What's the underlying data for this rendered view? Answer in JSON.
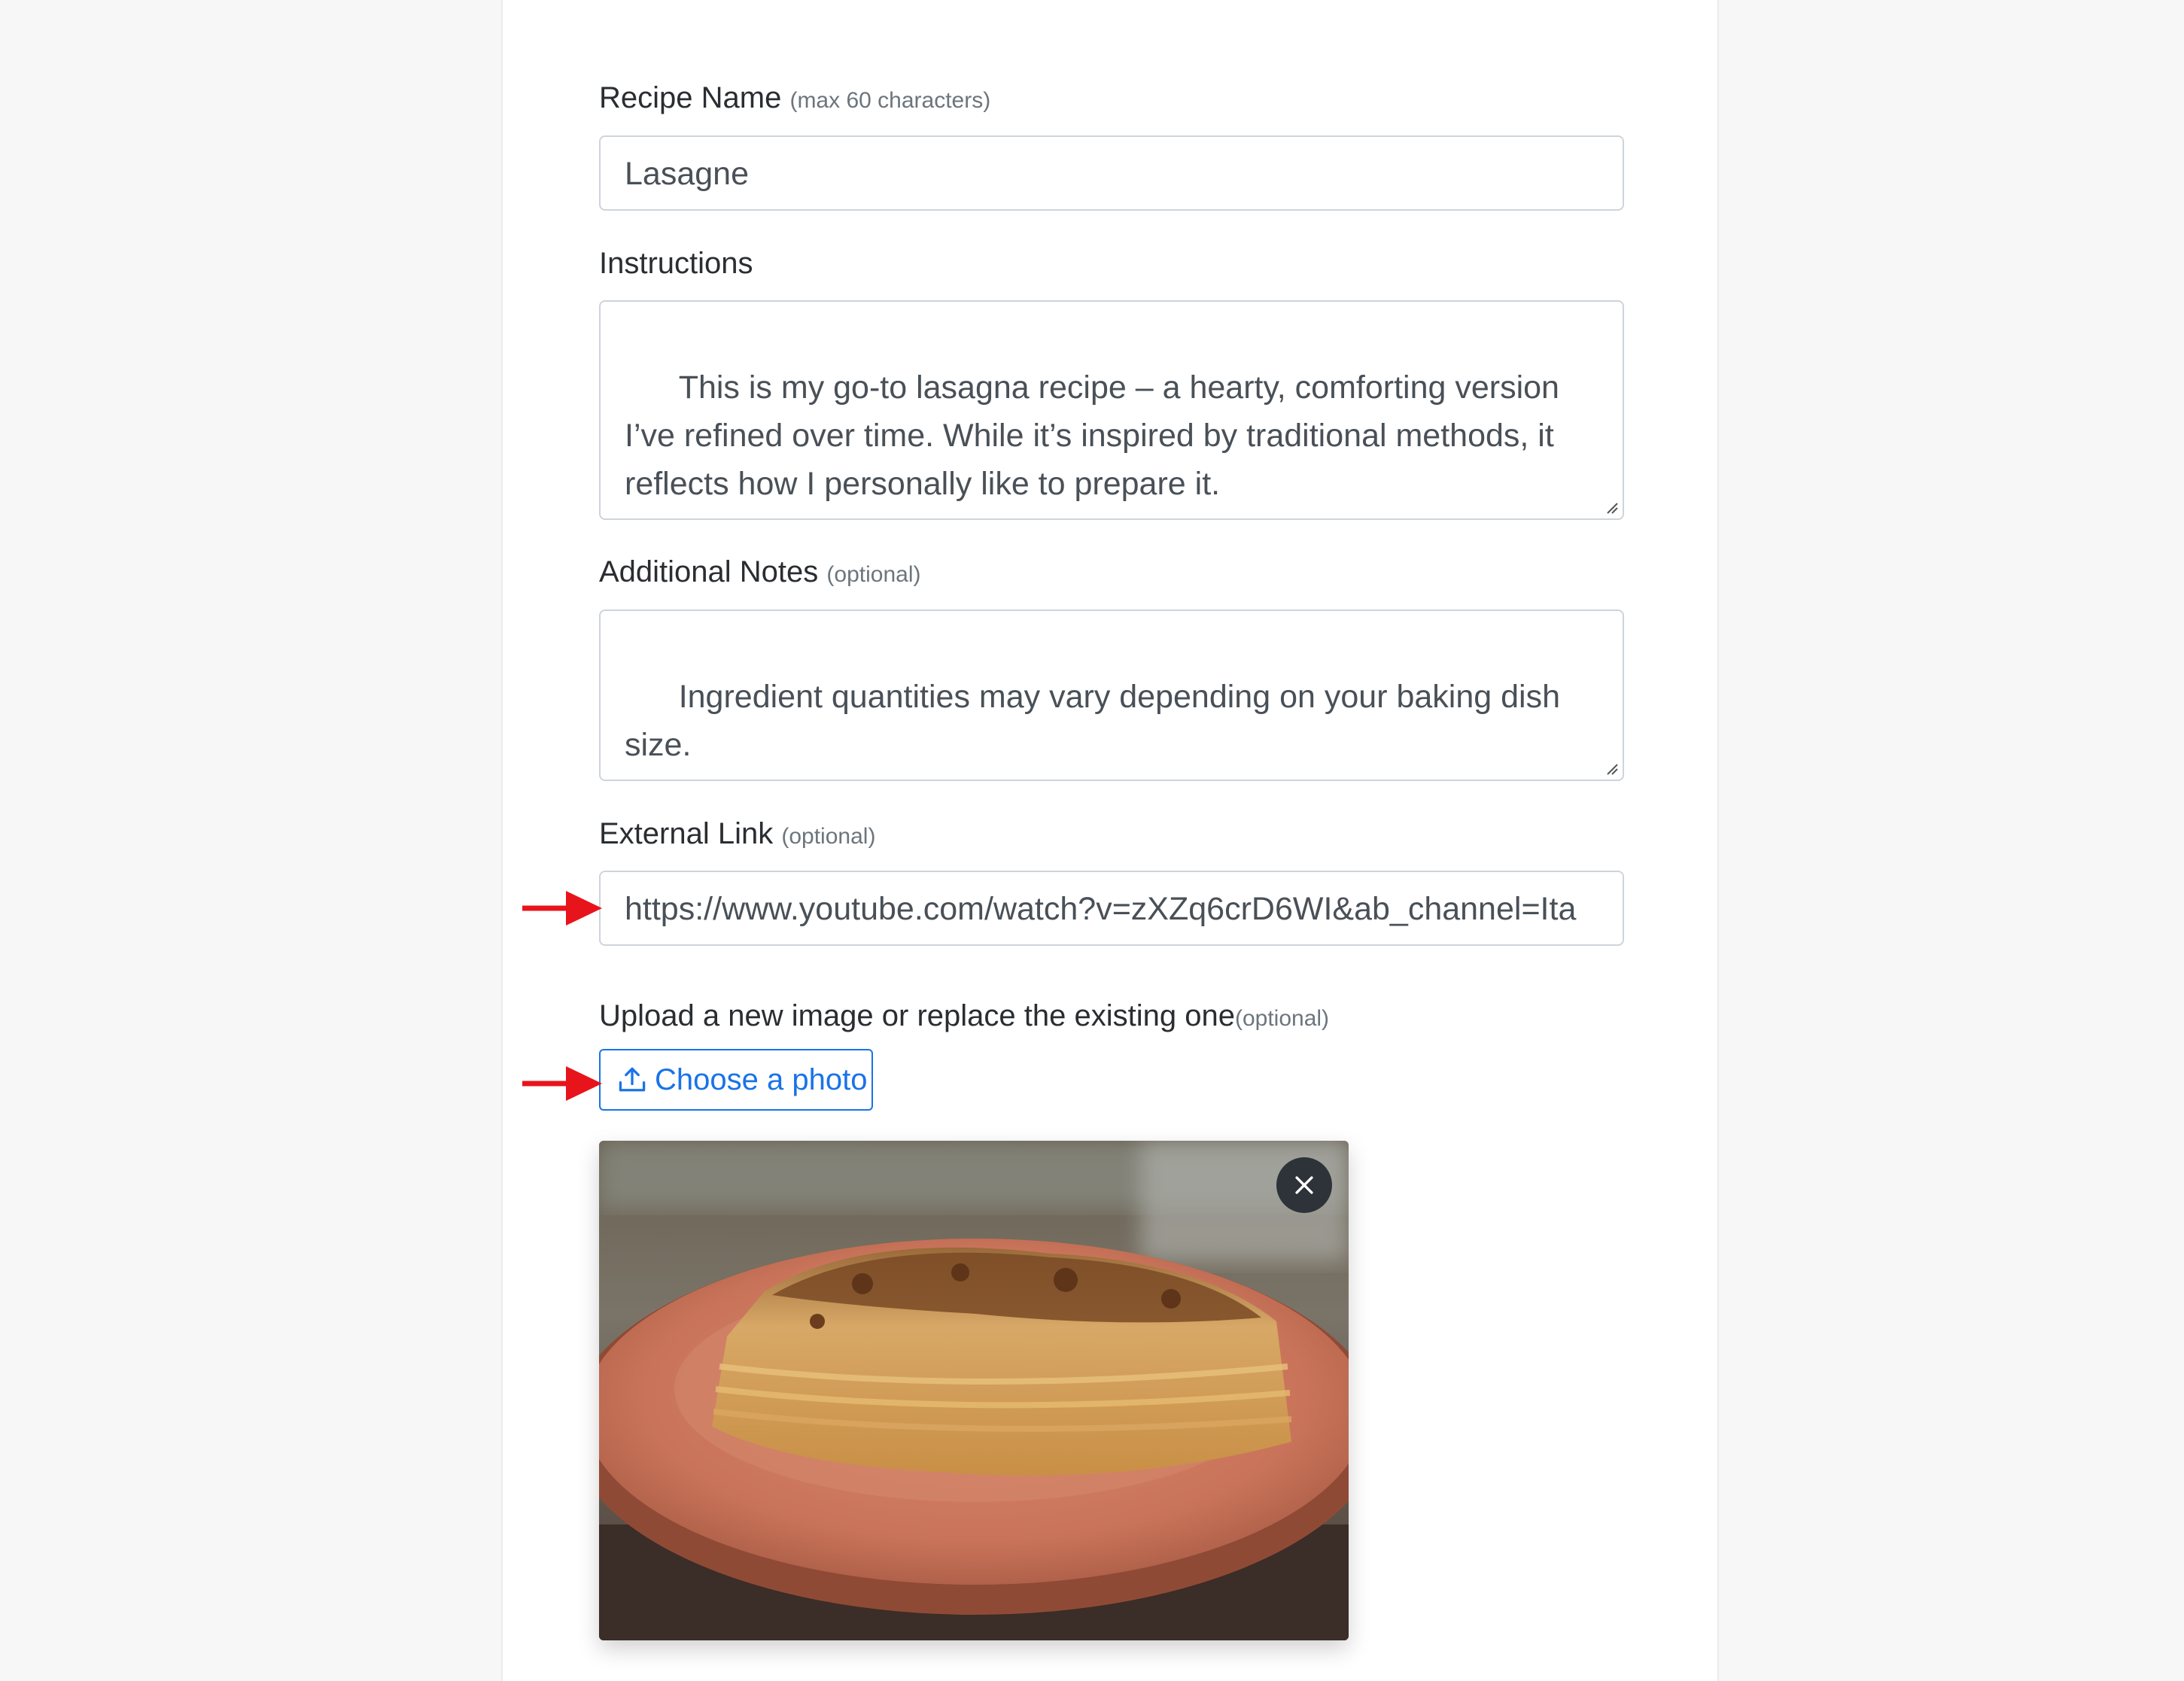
{
  "form": {
    "recipe_name": {
      "label": "Recipe Name",
      "hint": "(max 60 characters)",
      "value": "Lasagne"
    },
    "instructions": {
      "label": "Instructions",
      "value": "This is my go-to lasagna recipe – a hearty, comforting version I’ve refined over time. While it’s inspired by traditional methods, it reflects how I personally like to prepare it."
    },
    "additional_notes": {
      "label": "Additional Notes",
      "hint": "(optional)",
      "value": "Ingredient quantities may vary depending on your baking dish size."
    },
    "external_link": {
      "label": "External Link",
      "hint": "(optional)",
      "value": "https://www.youtube.com/watch?v=zXZq6crD6WI&ab_channel=Ita"
    },
    "upload": {
      "label": "Upload a new image or replace the existing one",
      "hint": "(optional)",
      "button_label": "Choose a photo",
      "image_icon": "upload-icon",
      "remove_icon": "close-icon"
    }
  },
  "annotations": {
    "arrow_color": "#e8141b"
  },
  "colors": {
    "accent": "#1a73e8",
    "close_button_bg": "#2d3338"
  }
}
